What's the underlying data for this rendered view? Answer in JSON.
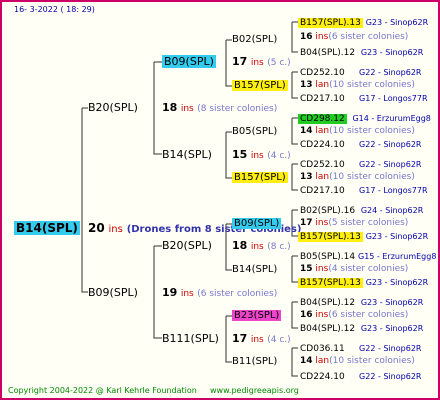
{
  "header": {
    "date": "16-  3-2022 ( 18:  29)"
  },
  "footer": {
    "copyright": "Copyright 2004-2022 @ Karl Kehrle Foundation",
    "site": "www.pedigreeapis.org"
  },
  "colors": {
    "border": "#cc0066",
    "cyan": "#33ccee",
    "yellow": "#ffee11",
    "green": "#22cc22",
    "pink": "#ee44cc"
  },
  "root": {
    "name": "B14(SPL)",
    "gen": "20",
    "ins": "ins",
    "note": "(Drones from 8 sister colonies)"
  },
  "level1": [
    {
      "name": "B20(SPL)",
      "gen": "18",
      "ins": "ins",
      "note": "(8 sister colonies)"
    },
    {
      "name": "B09(SPL)",
      "gen": "19",
      "ins": "ins",
      "note": "(6 sister colonies)"
    }
  ],
  "level2": [
    {
      "name": "B09(SPL)",
      "gen": "17",
      "ins": "ins",
      "note": "(5 c.)"
    },
    {
      "name": "B14(SPL)",
      "gen": "15",
      "ins": "ins",
      "note": "(4 c.)"
    },
    {
      "name": "B20(SPL)",
      "gen": "18",
      "ins": "ins",
      "note": "(8 c.)"
    },
    {
      "name": "B111(SPL)",
      "gen": "17",
      "ins": "ins",
      "note": "(4 c.)"
    }
  ],
  "level3": [
    {
      "name": "B02(SPL)",
      "gen": "16",
      "ins": "ins",
      "note": "(6 sister colonies)"
    },
    {
      "name": "B157(SPL)",
      "gen": "13",
      "ins": "lan",
      "note": "(10 sister colonies)"
    },
    {
      "name": "B05(SPL)",
      "gen": "14",
      "ins": "lan",
      "note": "(10 sister colonies)"
    },
    {
      "name": "B157(SPL)",
      "gen": "13",
      "ins": "lan",
      "note": "(10 sister colonies)"
    },
    {
      "name": "B09(SPL)",
      "gen": "17",
      "ins": "ins",
      "note": "(5 sister colonies)"
    },
    {
      "name": "B14(SPL)",
      "gen": "15",
      "ins": "ins",
      "note": "(4 sister colonies)"
    },
    {
      "name": "B23(SPL)",
      "gen": "16",
      "ins": "ins",
      "note": "(6 sister colonies)"
    },
    {
      "name": "B11(SPL)",
      "gen": "14",
      "ins": "lan",
      "note": "(10 sister colonies)"
    }
  ],
  "level4": [
    {
      "name": "B157(SPL).13",
      "info": "G23 - Sinop62R"
    },
    {
      "name": "B04(SPL).12",
      "info": "G23 - Sinop62R"
    },
    {
      "name": "CD252.10",
      "info": "G22 - Sinop62R"
    },
    {
      "name": "CD217.10",
      "info": "G17 - Longos77R"
    },
    {
      "name": "CD298.12",
      "info": "G14 - ErzurumEgg8"
    },
    {
      "name": "CD224.10",
      "info": "G22 - Sinop62R"
    },
    {
      "name": "CD252.10",
      "info": "G22 - Sinop62R"
    },
    {
      "name": "CD217.10",
      "info": "G17 - Longos77R"
    },
    {
      "name": "B02(SPL).16",
      "info": "G24 - Sinop62R"
    },
    {
      "name": "B157(SPL).13",
      "info": "G23 - Sinop62R"
    },
    {
      "name": "B05(SPL).14",
      "info": "G15 - ErzurumEgg8"
    },
    {
      "name": "B157(SPL).13",
      "info": "G23 - Sinop62R"
    },
    {
      "name": "B04(SPL).12",
      "info": "G23 - Sinop62R"
    },
    {
      "name": "B04(SPL).12",
      "info": "G23 - Sinop62R"
    },
    {
      "name": "CD036.11",
      "info": "G22 - Sinop62R"
    },
    {
      "name": "CD224.10",
      "info": "G22 - Sinop62R"
    }
  ]
}
